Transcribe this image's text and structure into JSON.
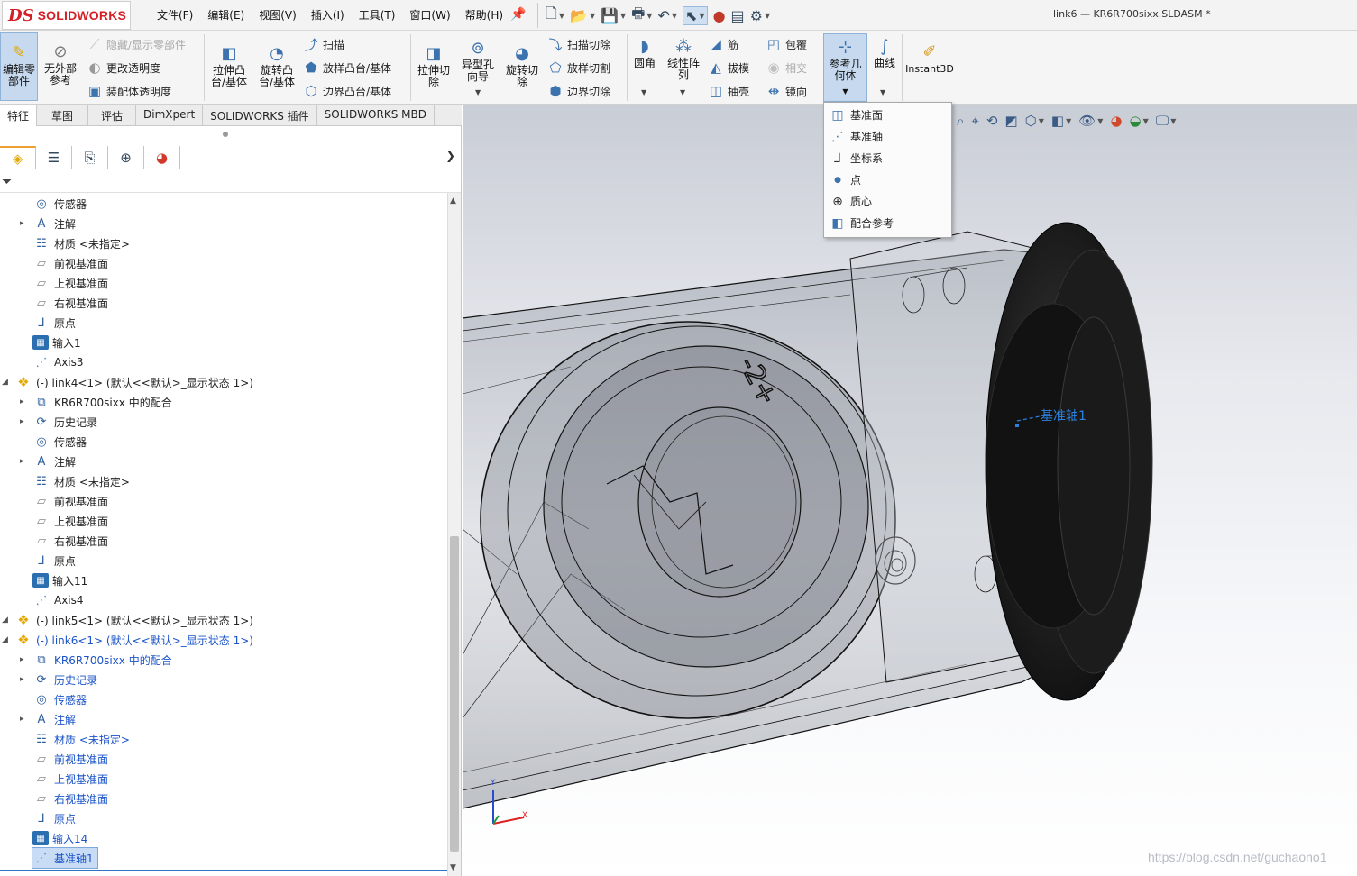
{
  "app": {
    "brand_prefix": "DS",
    "brand_name": "SOLIDWORKS",
    "document_title": "link6 — KR6R700sixx.SLDASM *"
  },
  "menu": [
    "文件(F)",
    "编辑(E)",
    "视图(V)",
    "插入(I)",
    "工具(T)",
    "窗口(W)",
    "帮助(H)"
  ],
  "quick_access_icons": [
    "new-icon",
    "open-icon",
    "save-icon",
    "print-icon",
    "undo-icon",
    "select-icon",
    "rebuild-icon",
    "options-icon",
    "settings-icon"
  ],
  "ribbon": {
    "edit_component": "编辑零\n部件",
    "no_external_refs": "无外部\n参考",
    "hide_show": "隐藏/显示零部件",
    "change_transparency": "更改透明度",
    "assembly_transparency": "装配体透明度",
    "extrude_boss": "拉伸凸\n台/基体",
    "revolve_boss": "旋转凸\n台/基体",
    "sweep": "扫描",
    "loft_boss": "放样凸台/基体",
    "boundary_boss": "边界凸台/基体",
    "extrude_cut": "拉伸切\n除",
    "hole_wizard": "异型孔\n向导",
    "revolve_cut": "旋转切\n除",
    "sweep_cut": "扫描切除",
    "loft_cut": "放样切割",
    "boundary_cut": "边界切除",
    "fillet": "圆角",
    "linear_pattern": "线性阵\n列",
    "rib": "筋",
    "draft": "拔模",
    "shell": "抽壳",
    "wrap": "包覆",
    "intersect": "相交",
    "mirror": "镜向",
    "reference_geometry": "参考几\n何体",
    "curves": "曲线",
    "instant3d": "Instant3D"
  },
  "tabs": [
    "特征",
    "草图",
    "评估",
    "DimXpert",
    "SOLIDWORKS 插件",
    "SOLIDWORKS MBD"
  ],
  "feature_manager_tabs": [
    "feature-tree-icon",
    "property-manager-icon",
    "configuration-manager-icon",
    "dimxpert-icon",
    "display-manager-icon"
  ],
  "tree": [
    {
      "label": "传感器",
      "icon": "sensor",
      "level": 2,
      "expand": false,
      "blue": false
    },
    {
      "label": "注解",
      "icon": "annotation",
      "level": 2,
      "expand": true,
      "blue": false
    },
    {
      "label": "材质 <未指定>",
      "icon": "material",
      "level": 2,
      "expand": false,
      "blue": false
    },
    {
      "label": "前视基准面",
      "icon": "plane",
      "level": 2,
      "expand": false,
      "blue": false
    },
    {
      "label": "上视基准面",
      "icon": "plane",
      "level": 2,
      "expand": false,
      "blue": false
    },
    {
      "label": "右视基准面",
      "icon": "plane",
      "level": 2,
      "expand": false,
      "blue": false
    },
    {
      "label": "原点",
      "icon": "origin",
      "level": 2,
      "expand": false,
      "blue": false
    },
    {
      "label": "输入1",
      "icon": "body",
      "level": 2,
      "expand": false,
      "blue": false
    },
    {
      "label": "Axis3",
      "icon": "axis",
      "level": 2,
      "expand": false,
      "blue": false
    },
    {
      "label": "(-) link4<1> (默认<<默认>_显示状态 1>)",
      "icon": "assembly",
      "level": 1,
      "expand": true,
      "blue": false
    },
    {
      "label": "KR6R700sixx 中的配合",
      "icon": "mates",
      "level": 2,
      "expand": true,
      "blue": false
    },
    {
      "label": "历史记录",
      "icon": "history",
      "level": 2,
      "expand": true,
      "blue": false
    },
    {
      "label": "传感器",
      "icon": "sensor",
      "level": 2,
      "expand": false,
      "blue": false
    },
    {
      "label": "注解",
      "icon": "annotation",
      "level": 2,
      "expand": true,
      "blue": false
    },
    {
      "label": "材质 <未指定>",
      "icon": "material",
      "level": 2,
      "expand": false,
      "blue": false
    },
    {
      "label": "前视基准面",
      "icon": "plane",
      "level": 2,
      "expand": false,
      "blue": false
    },
    {
      "label": "上视基准面",
      "icon": "plane",
      "level": 2,
      "expand": false,
      "blue": false
    },
    {
      "label": "右视基准面",
      "icon": "plane",
      "level": 2,
      "expand": false,
      "blue": false
    },
    {
      "label": "原点",
      "icon": "origin",
      "level": 2,
      "expand": false,
      "blue": false
    },
    {
      "label": "输入11",
      "icon": "body",
      "level": 2,
      "expand": false,
      "blue": false
    },
    {
      "label": "Axis4",
      "icon": "axis",
      "level": 2,
      "expand": false,
      "blue": false
    },
    {
      "label": "(-) link5<1> (默认<<默认>_显示状态 1>)",
      "icon": "assembly",
      "level": 1,
      "expand": true,
      "blue": false
    },
    {
      "label": "(-) link6<1> (默认<<默认>_显示状态 1>)",
      "icon": "assembly",
      "level": 1,
      "expand": true,
      "blue": true
    },
    {
      "label": "KR6R700sixx 中的配合",
      "icon": "mates",
      "level": 2,
      "expand": true,
      "blue": true
    },
    {
      "label": "历史记录",
      "icon": "history",
      "level": 2,
      "expand": true,
      "blue": true
    },
    {
      "label": "传感器",
      "icon": "sensor",
      "level": 2,
      "expand": false,
      "blue": true
    },
    {
      "label": "注解",
      "icon": "annotation",
      "level": 2,
      "expand": true,
      "blue": true
    },
    {
      "label": "材质 <未指定>",
      "icon": "material",
      "level": 2,
      "expand": false,
      "blue": true
    },
    {
      "label": "前视基准面",
      "icon": "plane",
      "level": 2,
      "expand": false,
      "blue": true
    },
    {
      "label": "上视基准面",
      "icon": "plane",
      "level": 2,
      "expand": false,
      "blue": true
    },
    {
      "label": "右视基准面",
      "icon": "plane",
      "level": 2,
      "expand": false,
      "blue": true
    },
    {
      "label": "原点",
      "icon": "origin",
      "level": 2,
      "expand": false,
      "blue": true
    },
    {
      "label": "输入14",
      "icon": "body",
      "level": 2,
      "expand": false,
      "blue": true
    },
    {
      "label": "基准轴1",
      "icon": "axis",
      "level": 2,
      "expand": false,
      "blue": true,
      "selected": true
    }
  ],
  "dropdown": {
    "plane": "基准面",
    "axis": "基准轴",
    "coordinate_system": "坐标系",
    "point": "点",
    "center_of_mass": "质心",
    "mate_reference": "配合参考"
  },
  "viewport": {
    "axis_label": "基准轴1",
    "watermark": "https://blog.csdn.net/guchaono1",
    "triad_x": "X",
    "triad_y": "Y"
  },
  "colors": {
    "brand_red": "#d51f26",
    "selection_blue": "#1b54c9",
    "axis_blue": "#2d82e0"
  }
}
